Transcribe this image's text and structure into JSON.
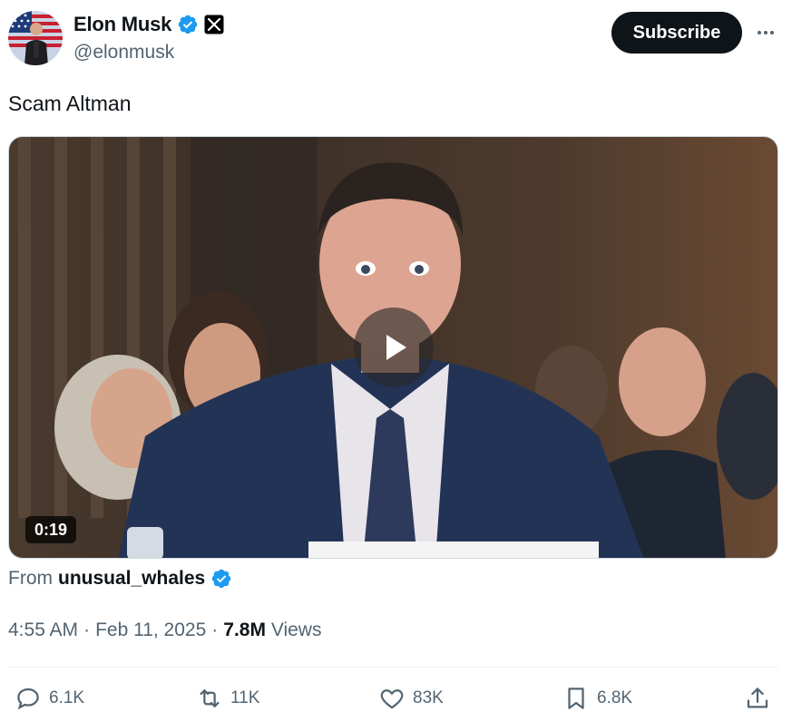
{
  "author": {
    "name": "Elon Musk",
    "handle": "@elonmusk",
    "avatar_icon": "avatar-photo",
    "verified_color": "#1d9bf0"
  },
  "header": {
    "subscribe_label": "Subscribe",
    "more_icon": "ellipsis-icon"
  },
  "tweet": {
    "text": "Scam Altman"
  },
  "media": {
    "duration": "0:19",
    "play_icon": "play-icon"
  },
  "source": {
    "from_label": "From",
    "name": "unusual_whales"
  },
  "meta": {
    "time": "4:55 AM",
    "sep1": "·",
    "date": "Feb 11, 2025",
    "sep2": "·",
    "views_count": "7.8M",
    "views_label": "Views"
  },
  "actions": {
    "replies": "6.1K",
    "reposts": "11K",
    "likes": "83K",
    "bookmarks": "6.8K"
  }
}
